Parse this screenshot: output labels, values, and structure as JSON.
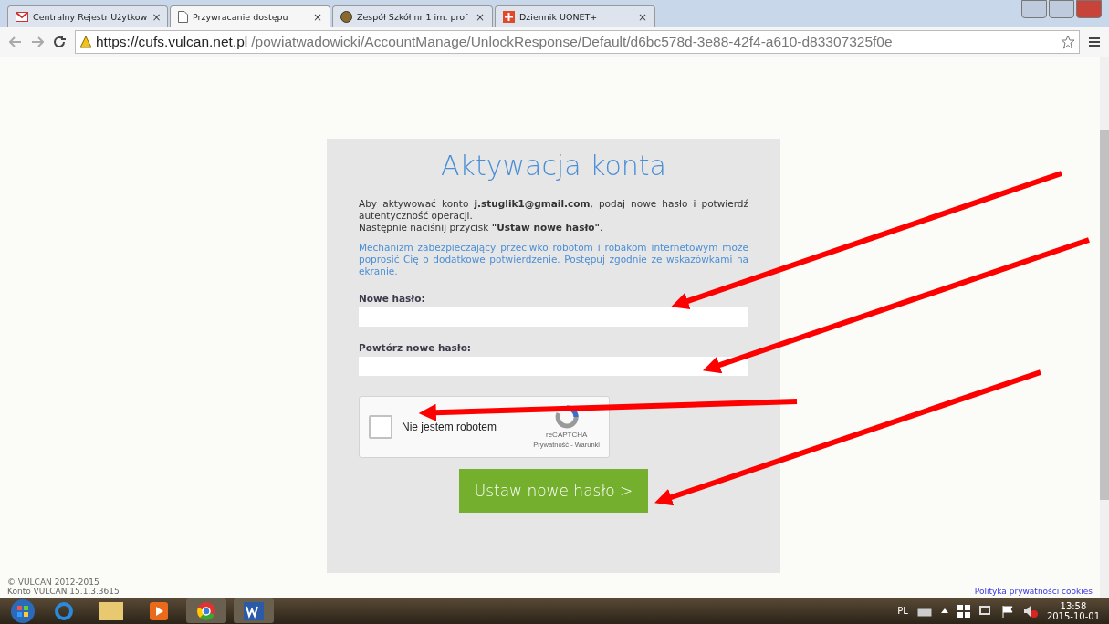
{
  "browser": {
    "tabs": [
      {
        "title": "Centralny Rejestr Użytkow",
        "selected": false,
        "close": "×"
      },
      {
        "title": "Przywracanie dostępu",
        "selected": true,
        "close": "×"
      },
      {
        "title": "Zespół Szkół nr 1 im. prof",
        "selected": false,
        "close": "×"
      },
      {
        "title": "Dziennik UONET+",
        "selected": false,
        "close": "×"
      }
    ],
    "url_host": "https://cufs.vulcan.net.pl",
    "url_path": "/powiatwadowicki/AccountManage/UnlockResponse/Default/d6bc578d-3e88-42f4-a610-d83307325f0e"
  },
  "form": {
    "title": "Aktywacja konta",
    "intro": "Aby aktywować konto **j.stuglik1@gmail.com**, podaj nowe hasło i potwierdź autentyczność operacji.",
    "intro2": "Następnie naciśnij przycisk **\"Ustaw nowe hasło\"**.",
    "notice": "Mechanizm zabezpieczający przeciwko robotom i robakom internetowym może poprosić Cię o dodatkowe potwierdzenie. Postępuj zgodnie ze wskazówkami na ekranie.",
    "fields": [
      {
        "label": "Nowe hasło:"
      },
      {
        "label": "Powtórz nowe hasło:"
      }
    ],
    "captcha": {
      "label": "Nie jestem robotem",
      "checked": false,
      "brand": "reCAPTCHA",
      "links": "Prywatność - Warunki"
    },
    "submit": "Ustaw nowe hasło >"
  },
  "footer": {
    "copyright": "© VULCAN 2012-2015",
    "version": "Konto VULCAN 15.1.3.3615",
    "policy_link": "Polityka prywatności cookies"
  },
  "taskbar": {
    "language": "PL",
    "time": "13:58",
    "date": "2015-10-01"
  }
}
